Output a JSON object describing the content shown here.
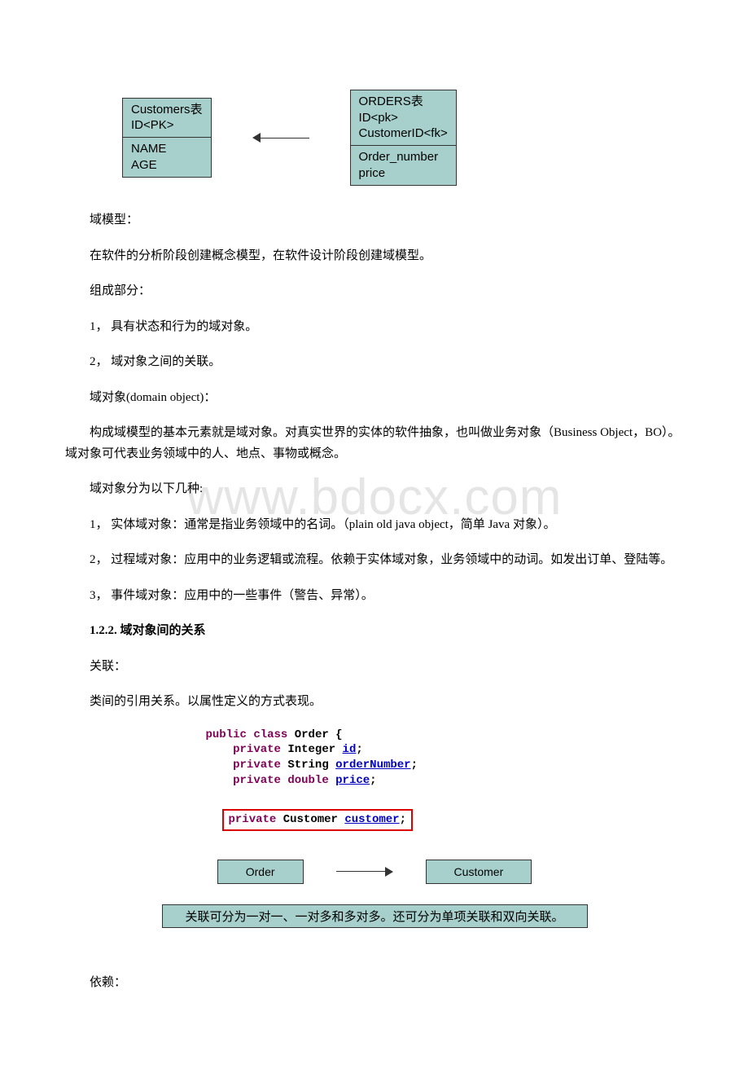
{
  "diagram1": {
    "left_box": {
      "header_lines": [
        "Customers表",
        "ID<PK>"
      ],
      "body_lines": [
        "NAME",
        "AGE"
      ]
    },
    "right_box": {
      "header_lines": [
        "ORDERS表",
        "ID<pk>",
        "CustomerID<fk>"
      ],
      "body_lines": [
        "Order_number",
        "price"
      ]
    }
  },
  "paragraphs": {
    "p1": "域模型：",
    "p2": "在软件的分析阶段创建概念模型，在软件设计阶段创建域模型。",
    "p3": "组成部分：",
    "p4": "1， 具有状态和行为的域对象。",
    "p5": "2， 域对象之间的关联。",
    "p6": "域对象(domain object)：",
    "p7": "构成域模型的基本元素就是域对象。对真实世界的实体的软件抽象，也叫做业务对象（Business Object，BO）。域对象可代表业务领域中的人、地点、事物或概念。",
    "p8": "域对象分为以下几种:",
    "p9": "1， 实体域对象：通常是指业务领域中的名词。（plain old java object，简单 Java 对象）。",
    "p10": "2， 过程域对象：应用中的业务逻辑或流程。依赖于实体域对象，业务领域中的动词。如发出订单、登陆等。",
    "p11": "3， 事件域对象：应用中的一些事件（警告、异常）。",
    "h1": "1.2.2. 域对象间的关系",
    "p12": "关联：",
    "p13": "类间的引用关系。以属性定义的方式表现。",
    "p14": "依赖："
  },
  "code": {
    "l1_kw1": "public",
    "l1_kw2": "class",
    "l1_typ": "Order",
    "l1_brace": " {",
    "l2_kw": "private",
    "l2_typ": "Integer",
    "l2_id": "id",
    "l2_semi": ";",
    "l3_kw": "private",
    "l3_typ": "String",
    "l3_id": "orderNumber",
    "l3_semi": ";",
    "l4_kw": "private",
    "l4_typ": "double",
    "l4_id": "price",
    "l4_semi": ";",
    "l5_kw": "private",
    "l5_typ": "Customer",
    "l5_id": "customer",
    "l5_semi": ";"
  },
  "diagram2": {
    "left": "Order",
    "right": "Customer"
  },
  "assoc_note": "关联可分为一对一、一对多和多对多。还可分为单项关联和双向关联。",
  "watermark": "www.bdocx.com"
}
